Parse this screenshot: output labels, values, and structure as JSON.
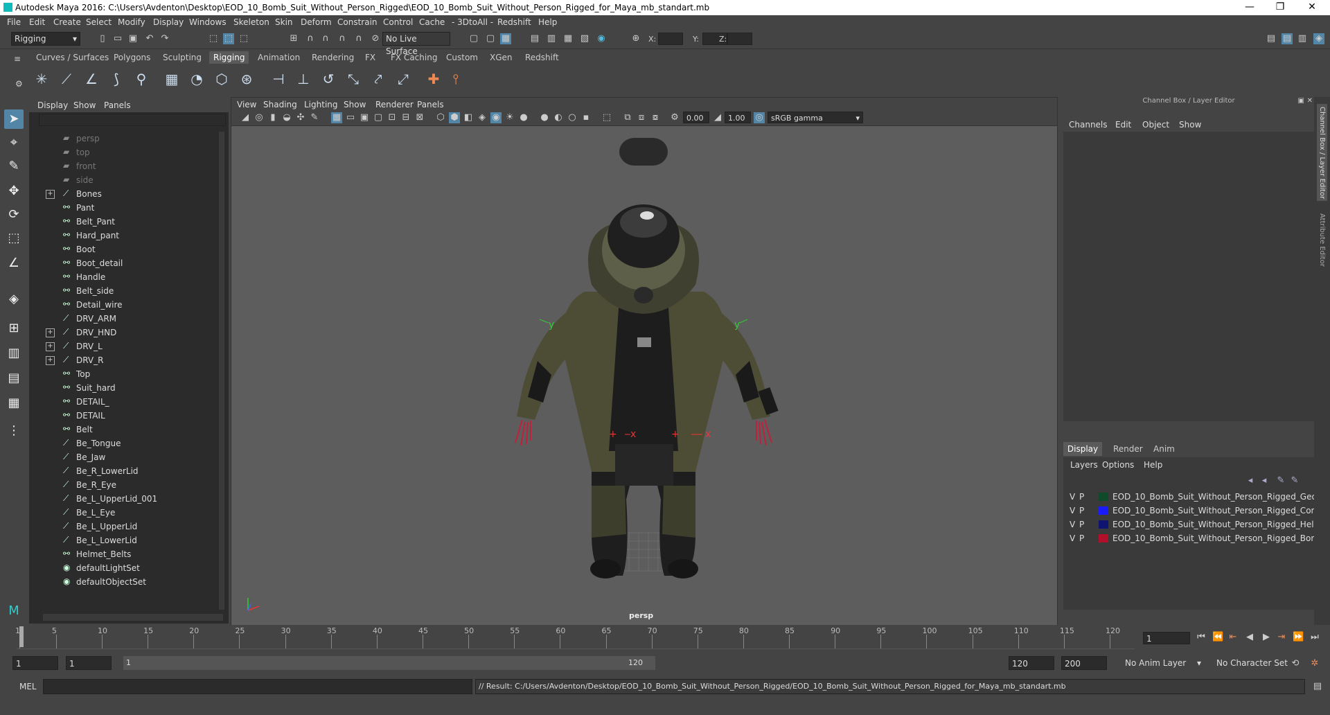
{
  "window": {
    "title": "Autodesk Maya 2016: C:\\Users\\Avdenton\\Desktop\\EOD_10_Bomb_Suit_Without_Person_Rigged\\EOD_10_Bomb_Suit_Without_Person_Rigged_for_Maya_mb_standart.mb",
    "min": "—",
    "max": "❐",
    "close": "✕"
  },
  "menubar": [
    "File",
    "Edit",
    "Create",
    "Select",
    "Modify",
    "Display",
    "Windows",
    "Skeleton",
    "Skin",
    "Deform",
    "Constrain",
    "Control",
    "Cache",
    "- 3DtoAll -",
    "Redshift",
    "Help"
  ],
  "status": {
    "mode": "Rigging",
    "live_surface": "No Live Surface",
    "x_label": "X:",
    "y_label": "Y:",
    "z_label": "Z:"
  },
  "shelf_tabs": [
    "Curves / Surfaces",
    "Polygons",
    "Sculpting",
    "Rigging",
    "Animation",
    "Rendering",
    "FX",
    "FX Caching",
    "Custom",
    "XGen",
    "Redshift"
  ],
  "shelf_active": "Rigging",
  "outliner": {
    "menu": [
      "Display",
      "Show",
      "Panels"
    ],
    "items": [
      {
        "label": "persp",
        "icon": "camera",
        "dim": true,
        "expand": false
      },
      {
        "label": "top",
        "icon": "camera",
        "dim": true,
        "expand": false
      },
      {
        "label": "front",
        "icon": "camera",
        "dim": true,
        "expand": false
      },
      {
        "label": "side",
        "icon": "camera",
        "dim": true,
        "expand": false
      },
      {
        "label": "Bones",
        "icon": "joint",
        "dim": false,
        "expand": true
      },
      {
        "label": "Pant",
        "icon": "transform",
        "dim": false,
        "expand": false
      },
      {
        "label": "Belt_Pant",
        "icon": "transform",
        "dim": false,
        "expand": false
      },
      {
        "label": "Hard_pant",
        "icon": "transform",
        "dim": false,
        "expand": false
      },
      {
        "label": "Boot",
        "icon": "transform",
        "dim": false,
        "expand": false
      },
      {
        "label": "Boot_detail",
        "icon": "transform",
        "dim": false,
        "expand": false
      },
      {
        "label": "Handle",
        "icon": "transform",
        "dim": false,
        "expand": false
      },
      {
        "label": "Belt_side",
        "icon": "transform",
        "dim": false,
        "expand": false
      },
      {
        "label": "Detail_wire",
        "icon": "transform",
        "dim": false,
        "expand": false
      },
      {
        "label": "DRV_ARM",
        "icon": "joint",
        "dim": false,
        "expand": false
      },
      {
        "label": "DRV_HND",
        "icon": "joint",
        "dim": false,
        "expand": true
      },
      {
        "label": "DRV_L",
        "icon": "joint",
        "dim": false,
        "expand": true
      },
      {
        "label": "DRV_R",
        "icon": "joint",
        "dim": false,
        "expand": true
      },
      {
        "label": "Top",
        "icon": "transform",
        "dim": false,
        "expand": false
      },
      {
        "label": "Suit_hard",
        "icon": "transform",
        "dim": false,
        "expand": false
      },
      {
        "label": "DETAIL_",
        "icon": "transform",
        "dim": false,
        "expand": false
      },
      {
        "label": "DETAIL",
        "icon": "transform",
        "dim": false,
        "expand": false
      },
      {
        "label": "Belt",
        "icon": "transform",
        "dim": false,
        "expand": false
      },
      {
        "label": "Be_Tongue",
        "icon": "joint",
        "dim": false,
        "expand": false
      },
      {
        "label": "Be_Jaw",
        "icon": "joint",
        "dim": false,
        "expand": false
      },
      {
        "label": "Be_R_LowerLid",
        "icon": "joint",
        "dim": false,
        "expand": false
      },
      {
        "label": "Be_R_Eye",
        "icon": "joint",
        "dim": false,
        "expand": false
      },
      {
        "label": "Be_L_UpperLid_001",
        "icon": "joint",
        "dim": false,
        "expand": false
      },
      {
        "label": "Be_L_Eye",
        "icon": "joint",
        "dim": false,
        "expand": false
      },
      {
        "label": "Be_L_UpperLid",
        "icon": "joint",
        "dim": false,
        "expand": false
      },
      {
        "label": "Be_L_LowerLid",
        "icon": "joint",
        "dim": false,
        "expand": false
      },
      {
        "label": "Helmet_Belts",
        "icon": "transform",
        "dim": false,
        "expand": false
      },
      {
        "label": "defaultLightSet",
        "icon": "set",
        "dim": false,
        "expand": false
      },
      {
        "label": "defaultObjectSet",
        "icon": "set",
        "dim": false,
        "expand": false
      }
    ]
  },
  "viewport": {
    "menu": [
      "View",
      "Shading",
      "Lighting",
      "Show",
      "Renderer",
      "Panels"
    ],
    "field1": "0.00",
    "field2": "1.00",
    "colorspace": "sRGB gamma",
    "camera_label": "persp"
  },
  "channel_box": {
    "title": "Channel Box / Layer Editor",
    "menu": [
      "Channels",
      "Edit",
      "Object",
      "Show"
    ],
    "side_tabs": [
      "Channel Box / Layer Editor",
      "Attribute Editor"
    ]
  },
  "layer_editor": {
    "tabs": [
      "Display",
      "Render",
      "Anim"
    ],
    "menu": [
      "Layers",
      "Options",
      "Help"
    ],
    "layers": [
      {
        "v": "V",
        "p": "P",
        "name": "EOD_10_Bomb_Suit_Without_Person_Rigged_Geometry",
        "color": "#0f4a2a"
      },
      {
        "v": "V",
        "p": "P",
        "name": "EOD_10_Bomb_Suit_Without_Person_Rigged_Controllers",
        "color": "#1a1aff"
      },
      {
        "v": "V",
        "p": "P",
        "name": "EOD_10_Bomb_Suit_Without_Person_Rigged_Helpers",
        "color": "#0e1470"
      },
      {
        "v": "V",
        "p": "P",
        "name": "EOD_10_Bomb_Suit_Without_Person_Rigged_Bones",
        "color": "#b0102a"
      }
    ]
  },
  "timeline": {
    "ticks": [
      "1",
      "5",
      "10",
      "15",
      "20",
      "25",
      "30",
      "35",
      "40",
      "45",
      "50",
      "55",
      "60",
      "65",
      "70",
      "75",
      "80",
      "85",
      "90",
      "95",
      "100",
      "105",
      "110",
      "115",
      "120"
    ],
    "current": "1"
  },
  "range": {
    "start": "1",
    "start2": "1",
    "slider_start": "1",
    "slider_end": "120",
    "end": "120",
    "end2": "200",
    "anim_layer": "No Anim Layer",
    "char_set": "No Character Set"
  },
  "cmdline": {
    "lang": "MEL",
    "result": "// Result: C:/Users/Avdenton/Desktop/EOD_10_Bomb_Suit_Without_Person_Rigged/EOD_10_Bomb_Suit_Without_Person_Rigged_for_Maya_mb_standart.mb"
  }
}
